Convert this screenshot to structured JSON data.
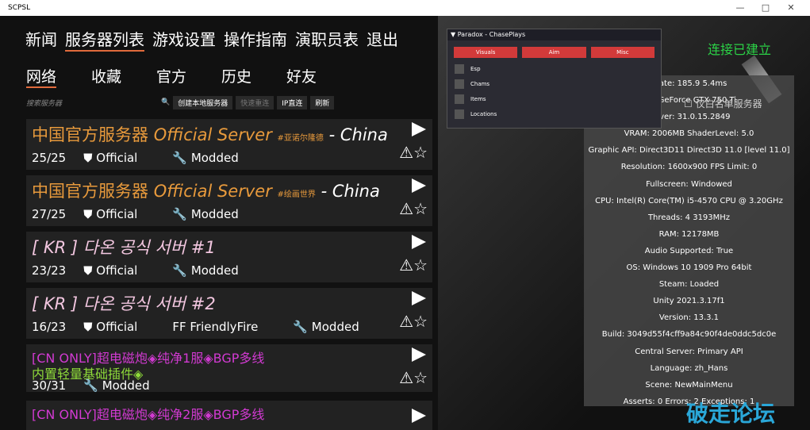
{
  "window": {
    "title": "SCPSL",
    "btns": [
      "—",
      "□",
      "✕"
    ]
  },
  "nav": [
    "新闻",
    "服务器列表",
    "游戏设置",
    "操作指南",
    "演职员表",
    "退出"
  ],
  "tabs": [
    "网络",
    "收藏",
    "官方",
    "历史",
    "好友"
  ],
  "toolbar": {
    "search": "搜索服务器",
    "create": "创建本地服务器",
    "refresh_quick": "快速重连",
    "ip": "IP直连",
    "refresh": "刷新"
  },
  "servers": [
    {
      "title": "中国官方服务器",
      "eng": "Official Server",
      "tag": "#亚诺尔隆德",
      "suffix": "- China",
      "players": "25/25",
      "official": "Official",
      "modded": "Modded"
    },
    {
      "title": "中国官方服务器",
      "eng": "Official Server",
      "tag": "#绘画世界",
      "suffix": "- China",
      "players": "27/25",
      "official": "Official",
      "modded": "Modded"
    },
    {
      "title": "[ KR ] 다온 공식 서버 #1",
      "players": "23/23",
      "official": "Official",
      "modded": "Modded"
    },
    {
      "title": "[ KR ] 다온 공식 서버 #2",
      "players": "16/23",
      "official": "Official",
      "ff": "FriendlyFire",
      "modded": "Modded"
    },
    {
      "title": "[CN ONLY]超电磁炮◈纯净1服◈BGP多线",
      "line2": "内置轻量基础插件◈",
      "players": "30/31",
      "modded": "Modded"
    },
    {
      "title": "[CN ONLY]超电磁炮◈纯净2服◈BGP多线"
    }
  ],
  "cheat": {
    "header": "▼ Paradox - ChasePlays",
    "btns": [
      "Visuals",
      "Aim",
      "Misc"
    ],
    "items": [
      "Esp",
      "Chams",
      "Items",
      "Locations"
    ]
  },
  "status": "连接已建立",
  "whitelist": "仅白名单服务器",
  "debug": [
    "erate: 185.9  5.4ms",
    "DIA GeForce GTX 750 Ti",
    "Driver: 31.0.15.2849",
    "VRAM: 2006MB ShaderLevel: 5.0",
    "Graphic API: Direct3D11 Direct3D 11.0 [level 11.0]",
    "Resolution: 1600x900  FPS Limit: 0",
    "Fullscreen: Windowed",
    "CPU: Intel(R) Core(TM) i5-4570 CPU @ 3.20GHz",
    "Threads: 4   3193MHz",
    "RAM: 12178MB",
    "Audio Supported: True",
    "OS: Windows 10 1909 Pro 64bit",
    "Steam: Loaded",
    "Unity 2021.3.17f1",
    "Version: 13.3.1",
    "Build: 3049d55f4cff9a84c90f4de0ddc5dc0e",
    "Central Server: Primary API",
    "Language: zh_Hans",
    "Scene: NewMainMenu",
    "Asserts: 0 Errors: 2 Exceptions: 1"
  ],
  "watermark": "破走论坛"
}
